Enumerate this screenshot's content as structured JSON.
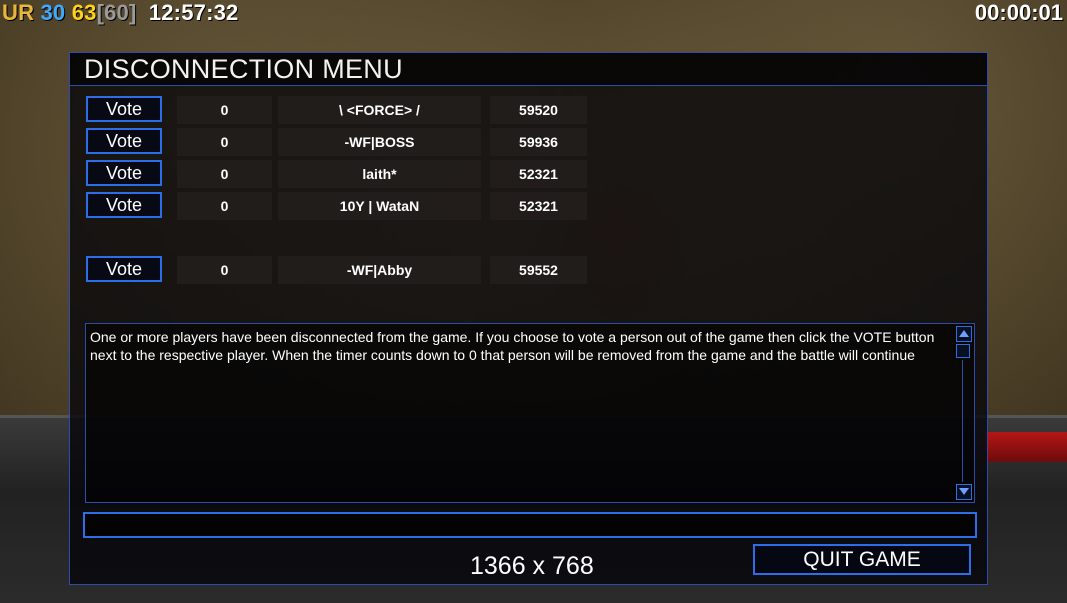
{
  "hud": {
    "ur": "UR",
    "num1": "30",
    "num2": "63",
    "fps": "[60]",
    "clock": "12:57:32",
    "timer": "00:00:01"
  },
  "dialog": {
    "title": "DISCONNECTION MENU",
    "vote_label": "Vote",
    "players": [
      {
        "votes": "0",
        "name": "\\ <FORCE> /",
        "ping": "59520"
      },
      {
        "votes": "0",
        "name": "-WF|BOSS",
        "ping": "59936"
      },
      {
        "votes": "0",
        "name": "laith*",
        "ping": "52321"
      },
      {
        "votes": "0",
        "name": "10Y | WataN",
        "ping": "52321"
      },
      {
        "votes": "0",
        "name": "-WF|Abby",
        "ping": "59552"
      }
    ],
    "message": "One or more players have been disconnected from the game. If you choose to vote a person out of the game then click the VOTE button next to the respective player. When the timer counts down to 0 that person will be removed from the game and the battle will continue",
    "chat_value": "",
    "resolution": "1366 x 768",
    "quit_label": "QUIT GAME"
  }
}
